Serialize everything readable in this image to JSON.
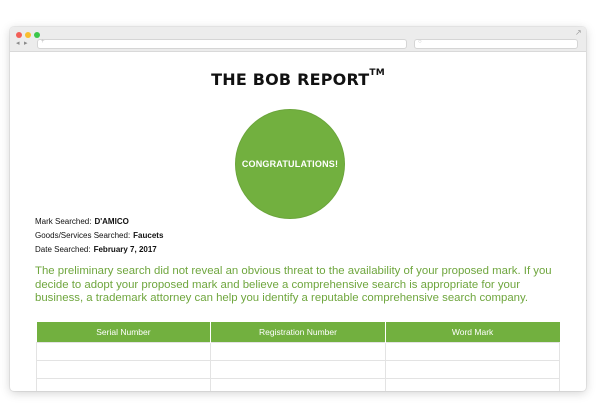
{
  "browser": {
    "nav_back": "◂",
    "nav_forward": "▸",
    "url_icon": "+",
    "search_icon": "○",
    "expand_icon": "↗"
  },
  "report": {
    "title": "THE BOB REPORT",
    "trademark": "TM",
    "badge_text": "CONGRATULATIONS!",
    "badge_color": "#72b03f",
    "accent_text_color": "#6fa63e"
  },
  "meta": [
    {
      "label": "Mark Searched:",
      "value": "D'AMICO"
    },
    {
      "label": "Goods/Services Searched:",
      "value": "Faucets"
    },
    {
      "label": "Date Searched:",
      "value": "February 7, 2017"
    }
  ],
  "result_text": "The preliminary search did not reveal an obvious threat to the availability of your proposed mark. If you decide to adopt your proposed mark and believe a comprehensive search is appropriate for your business, a trademark attorney can help you identify a reputable comprehensive search company.",
  "table": {
    "headers": [
      "Serial Number",
      "Registration Number",
      "Word Mark"
    ],
    "rows": [
      [
        "",
        "",
        ""
      ],
      [
        "",
        "",
        ""
      ],
      [
        "",
        "",
        ""
      ]
    ]
  }
}
